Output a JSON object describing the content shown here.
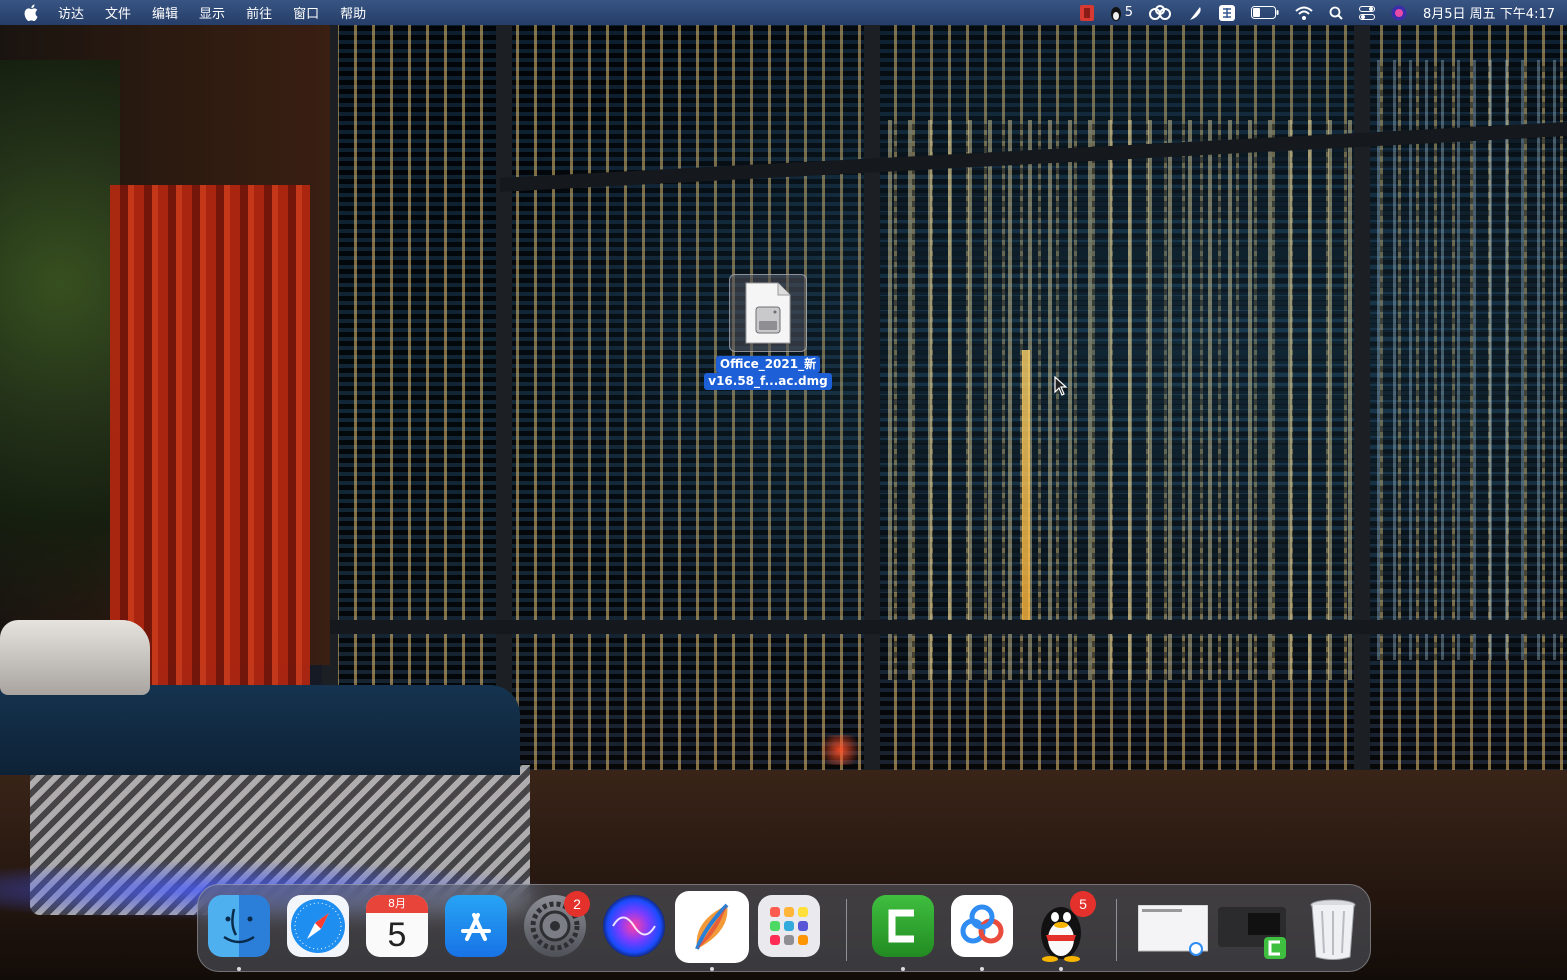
{
  "menubar": {
    "app_menus": [
      "访达",
      "文件",
      "编辑",
      "显示",
      "前往",
      "窗口",
      "帮助"
    ],
    "status_items": {
      "qq_count": "5",
      "datetime": "8月5日 周五 下午4:17"
    }
  },
  "desktop": {
    "file": {
      "name_line1": "Office_2021_新",
      "name_line2": "v16.58_f...ac.dmg",
      "icon": "disk-image-icon",
      "selected": true
    }
  },
  "dock": {
    "apps": [
      {
        "name": "Finder",
        "icon": "finder-icon",
        "running": true
      },
      {
        "name": "Safari",
        "icon": "safari-icon",
        "running": false
      },
      {
        "name": "Calendar",
        "icon": "calendar-icon",
        "running": false,
        "month": "8月",
        "day": "5"
      },
      {
        "name": "App Store",
        "icon": "appstore-icon",
        "running": false
      },
      {
        "name": "System Preferences",
        "icon": "settings-icon",
        "running": false,
        "badge": "2"
      },
      {
        "name": "Siri",
        "icon": "siri-icon",
        "running": false
      },
      {
        "name": "Lark",
        "icon": "lark-icon",
        "running": true
      },
      {
        "name": "Launchpad",
        "icon": "launchpad-icon",
        "running": false
      },
      {
        "name": "Camtasia",
        "icon": "camtasia-icon",
        "running": true
      },
      {
        "name": "Baidu Netdisk",
        "icon": "netdisk-icon",
        "running": true
      },
      {
        "name": "QQ",
        "icon": "qq-icon",
        "running": true,
        "badge": "5"
      }
    ],
    "minimized": [
      {
        "name": "netdisk-window",
        "icon": "document-thumbnail-icon"
      },
      {
        "name": "camtasia-window",
        "icon": "terminal-thumbnail-icon"
      }
    ],
    "trash": {
      "name": "Trash",
      "icon": "trash-icon"
    }
  },
  "colors": {
    "menubar": "#35598f",
    "selection": "#1c5fd6",
    "badge": "#e5312b"
  }
}
